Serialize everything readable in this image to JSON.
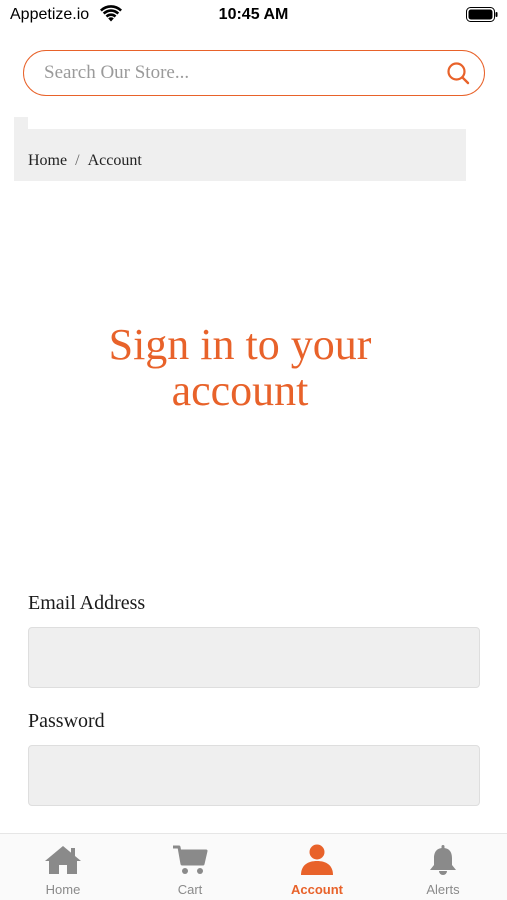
{
  "status_bar": {
    "carrier": "Appetize.io",
    "time": "10:45 AM"
  },
  "search": {
    "placeholder": "Search Our Store..."
  },
  "breadcrumb": {
    "home": "Home",
    "separator": "/",
    "current": "Account"
  },
  "page": {
    "title": "Sign in to your account"
  },
  "form": {
    "email_label": "Email Address",
    "email_value": "",
    "password_label": "Password",
    "password_value": ""
  },
  "tab_bar": {
    "active": "account",
    "tabs": [
      {
        "key": "home",
        "label": "Home",
        "icon": "home-icon"
      },
      {
        "key": "cart",
        "label": "Cart",
        "icon": "cart-icon"
      },
      {
        "key": "account",
        "label": "Account",
        "icon": "person-icon"
      },
      {
        "key": "alerts",
        "label": "Alerts",
        "icon": "bell-icon"
      }
    ]
  },
  "colors": {
    "accent": "#e8622a",
    "inactive_tab": "#8a8a8a",
    "field_bg": "#efefef"
  }
}
